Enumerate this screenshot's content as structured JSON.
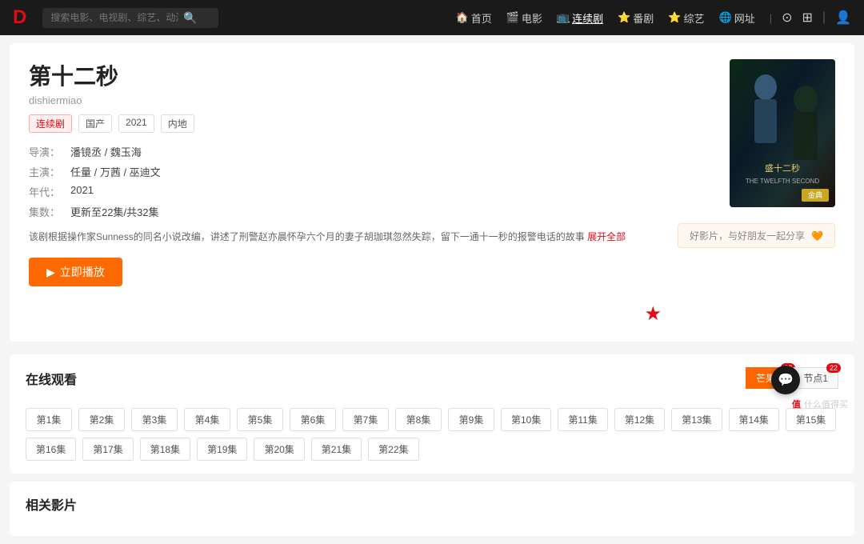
{
  "header": {
    "logo": "D",
    "search": {
      "placeholder": "搜索电影、电视剧、综艺、动漫",
      "icon": "🔍"
    },
    "nav": [
      {
        "label": "首页",
        "icon": "🏠",
        "active": false
      },
      {
        "label": "电影",
        "icon": "🎬",
        "active": false
      },
      {
        "label": "连续剧",
        "icon": "📺",
        "active": true
      },
      {
        "label": "番剧",
        "icon": "⭐",
        "active": false
      },
      {
        "label": "综艺",
        "icon": "⭐",
        "active": false
      },
      {
        "label": "网址",
        "icon": "🌐",
        "active": false
      }
    ],
    "right_icons": [
      "⊙",
      "⊞",
      "|",
      "👤"
    ]
  },
  "detail": {
    "title_cn": "第十二秒",
    "title_pinyin": "dishiermiao",
    "tags": [
      {
        "label": "连续剧",
        "type": "drama"
      },
      {
        "label": "国产",
        "type": "normal"
      },
      {
        "label": "2021",
        "type": "normal"
      },
      {
        "label": "内地",
        "type": "normal"
      }
    ],
    "director_label": "导演：",
    "director_value": "潘镜丞 / 魏玉海",
    "cast_label": "主演：",
    "cast_value": "任量 / 万茜 / 巫迪文",
    "year_label": "年代：",
    "year_value": "2021",
    "episode_label": "集数：",
    "episode_value": "更新至22集/共32集",
    "desc": "该剧根据操作家Sunness的同名小说改编，讲述了刑警赵亦晨怀孕六个月的妻子胡珈琪忽然失踪，留下一通十一秒的报警电话的故事",
    "desc_expand": "展开全部",
    "play_btn": "立即播放",
    "expand_label": "展开全部"
  },
  "share": {
    "text": "好影片，与好朋友一起分享",
    "icon": "🧡"
  },
  "episodes": {
    "section_title": "在线观看",
    "sources": [
      {
        "label": "芒果tv",
        "active": true,
        "badge": "22"
      },
      {
        "label": "节点1",
        "active": false,
        "badge": "22"
      }
    ],
    "episodes_row1": [
      "第1集",
      "第2集",
      "第3集",
      "第4集",
      "第5集",
      "第6集",
      "第7集",
      "第8集",
      "第9集",
      "第10集",
      "第11集",
      "第12集",
      "第13集",
      "第14集",
      "第15集"
    ],
    "episodes_row2": [
      "第16集",
      "第17集",
      "第18集",
      "第19集",
      "第20集",
      "第21集",
      "第22集"
    ]
  },
  "related": {
    "section_title": "相关影片"
  },
  "float": {
    "chat_icon": "💬",
    "watermark_logo": "值",
    "watermark_text": "什么值得买"
  },
  "colors": {
    "accent": "#e50914",
    "play_btn": "#ff6a00",
    "header_bg": "#1a1a1a"
  }
}
